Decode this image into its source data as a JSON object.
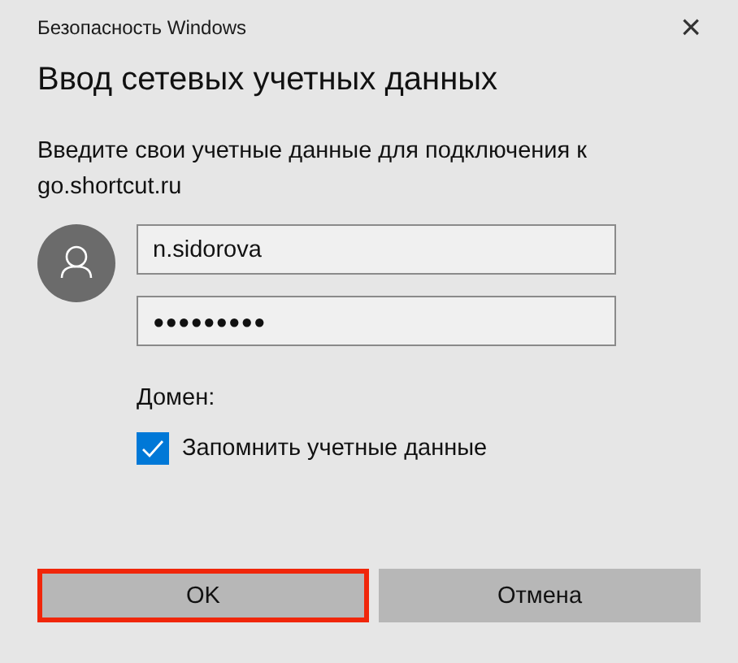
{
  "window": {
    "title": "Безопасность Windows",
    "close": "×"
  },
  "heading": "Ввод сетевых учетных данных",
  "message": "Введите свои учетные данные для подключения к go.shortcut.ru",
  "fields": [
    {
      "kind": "text",
      "value": "n.sidorova"
    },
    {
      "kind": "password",
      "value": "●●●●●●●●●"
    }
  ],
  "domain_label": "Домен:",
  "remember": {
    "label": "Запомнить учетные данные",
    "checked": true
  },
  "buttons": [
    {
      "label": "OK",
      "focused": true
    },
    {
      "label": "Отмена",
      "focused": false
    }
  ]
}
